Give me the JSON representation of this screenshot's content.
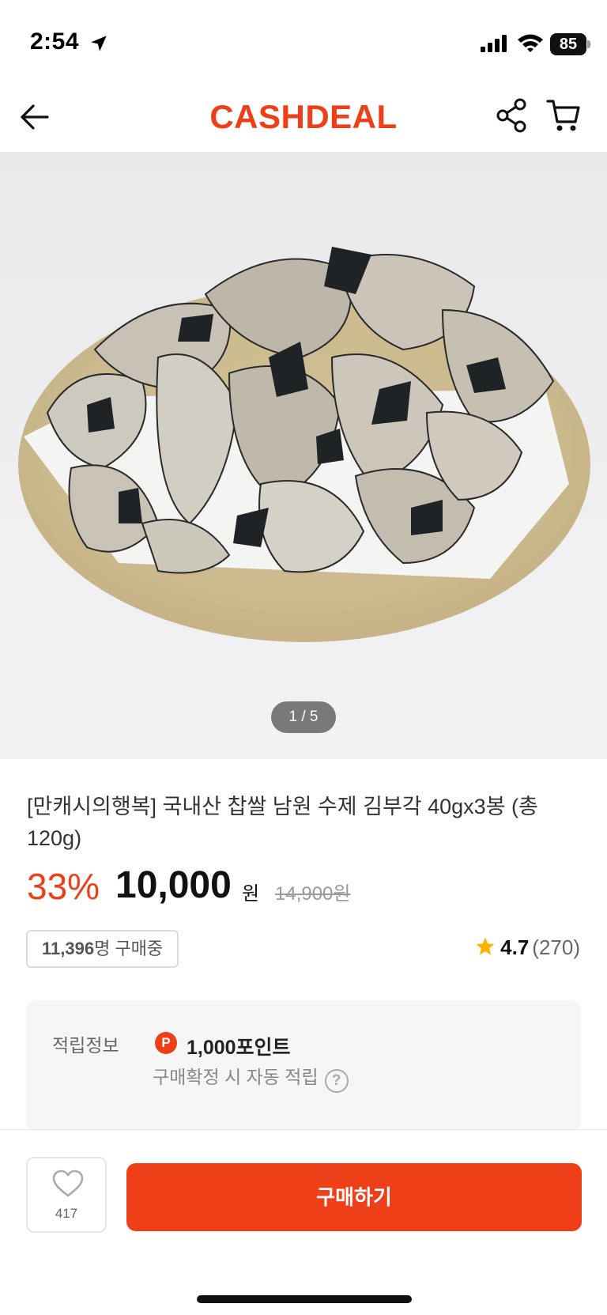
{
  "status_bar": {
    "time": "2:54",
    "battery": "85"
  },
  "header": {
    "brand": "CASHDEAL"
  },
  "gallery": {
    "pager": "1 / 5"
  },
  "product": {
    "title": "[만캐시의행복] 국내산 찹쌀 남원 수제 김부각 40gx3봉 (총 120g)",
    "discount": "33%",
    "price": "10,000",
    "price_unit": "원",
    "original_price": "14,900원",
    "buyers_count": "11,396",
    "buyers_suffix": "명 구매중",
    "rating": "4.7",
    "review_count": "(270)"
  },
  "points": {
    "label": "적립정보",
    "badge": "P",
    "amount": "1,000포인트",
    "note": "구매확정 시 자동 적립",
    "help": "?"
  },
  "bottom_bar": {
    "wish_count": "417",
    "buy_label": "구매하기"
  },
  "colors": {
    "accent": "#ee3f18",
    "star": "#f7b500"
  },
  "icons": [
    "location-arrow-icon",
    "signal-icon",
    "wifi-icon",
    "back-arrow-icon",
    "share-icon",
    "cart-icon",
    "star-icon",
    "help-icon",
    "heart-icon"
  ]
}
